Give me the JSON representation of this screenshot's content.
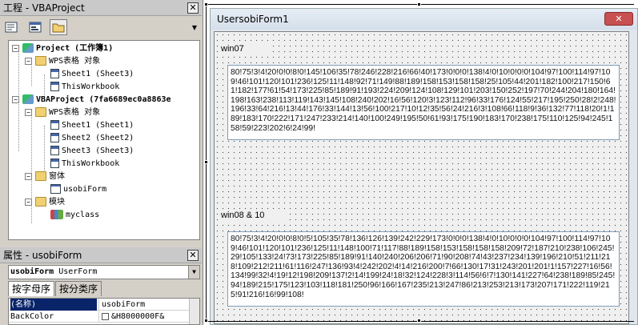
{
  "project_pane": {
    "title": "工程 - VBAProject",
    "close_label": "✕",
    "toolbar": {
      "view_code_icon": "view-code-icon",
      "view_object_icon": "view-object-icon",
      "toggle_folders_icon": "toggle-folders-icon"
    },
    "tree": [
      {
        "label": "Project (工作簿1)",
        "bold": true
      },
      {
        "label": "WPS表格 对象"
      },
      {
        "label": "Sheet1 (Sheet3)"
      },
      {
        "label": "ThisWorkbook"
      },
      {
        "label": "VBAProject (7fa6689ec0a8863e",
        "bold": true
      },
      {
        "label": "WPS表格 对象"
      },
      {
        "label": "Sheet1 (Sheet1)"
      },
      {
        "label": "Sheet2 (Sheet2)"
      },
      {
        "label": "Sheet3 (Sheet3)"
      },
      {
        "label": "ThisWorkbook"
      },
      {
        "label": "窗体"
      },
      {
        "label": "usobiForm"
      },
      {
        "label": "模块"
      },
      {
        "label": "myclass"
      }
    ],
    "expand_minus": "−"
  },
  "properties_pane": {
    "title": "属性 - usobiForm",
    "close_label": "✕",
    "object_name": "usobiForm",
    "object_type": "UserForm",
    "tabs": [
      "按字母序",
      "按分类序"
    ],
    "rows": [
      {
        "name": "(名称)",
        "value": "usobiForm"
      },
      {
        "name": "BackColor",
        "value": "&H8000000F&"
      }
    ]
  },
  "form": {
    "title": "UsersobiForm1",
    "close_label": "✕",
    "label1": "win07",
    "text1": "80!75!3!4!20!0!0!8!0!145!106!35!78!246!228!216!66!40!173!0!0!0!138!4!0!10!0!0!0!104!97!100!114!97!109!46!101!120!101!236!125!11!148!92!71!149!88!189!158!153!158!158!25!105!44!201!182!100!217!150!61!182!177!61!54!173!225!85!189!91!193!224!209!124!108!129!101!203!150!252!197!70!244!204!180!164!198!163!238!113!119!143!145!108!240!202!16!56!120!3!123!112!96!33!176!124!55!217!195!250!28!2!248!196!33!64!216!13!44!176!33!144!13!56!100!217!10!12!35!56!24!216!3!108!66!118!9!36!132!77!118!20!1!189!183!170!222!171!247!233!214!140!100!249!195!50!61!93!175!190!183!170!238!175!110!125!94!245!158!59!223!202!6!24!99!",
    "label2": "win08 & 10",
    "text2": "80!75!3!4!20!0!0!8!0!5!105!35!78!136!126!139!242!229!173!0!0!0!138!4!0!10!0!0!0!104!97!100!114!97!109!46!101!120!101!236!125!11!148!100!71!117!88!189!158!153!158!158!158!209!72!187!210!238!106!245!29!105!133!24!73!173!225!85!189!91!140!240!206!206!71!90!208!74!43!237!234!139!196!210!51!211!218!109!212!211!61!116!247!136!93!4!242!202!4!14!216!200!7!66!130!17!31!243!201!201!1!157!227!16!56!134!99!32!4!19!12!198!209!137!2!14!199!24!18!32!124!228!3!114!56!6!7!130!141!227!64!238!189!85!245!94!189!215!175!123!103!118!181!250!96!166!167!235!213!247!86!213!253!213!173!207!171!222!119!215!91!216!16!99!108!"
  }
}
